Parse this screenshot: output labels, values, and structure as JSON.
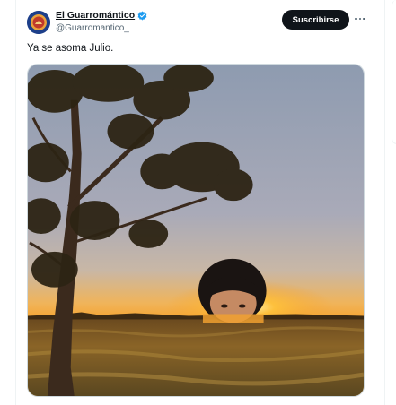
{
  "tweet": {
    "display_name": "El Guarromántico",
    "handle": "@Guarromantico_",
    "verified": true,
    "subscribe_label": "Suscribirse",
    "text": "Ya se asoma Julio.",
    "avatar_icon": "avatar-emblem-icon",
    "more_icon": "more-options-icon",
    "verified_color": "#1d9bf0"
  },
  "colors": {
    "subscribe_bg": "#0f1419",
    "handle": "#536471",
    "sky_top": "#8e9bb0",
    "sunset": "#f7a027"
  }
}
